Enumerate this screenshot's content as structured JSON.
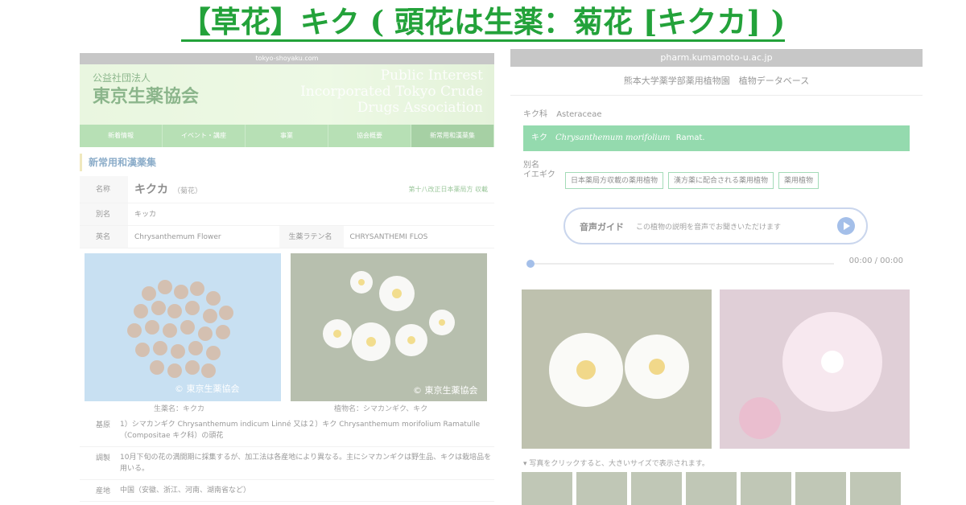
{
  "title": "【草花】キク ( 頭花は生薬：菊花 [キクカ] )",
  "left": {
    "url": "tokyo-shoyaku.com",
    "org_small": "公益社団法人",
    "org_big": "東京生薬協会",
    "org_eng": "Public Interest Incorporated Tokyo Crude Drugs Association",
    "nav": [
      "新着情報",
      "イベント・講座",
      "事業",
      "協会概要",
      "新常用和漢薬集"
    ],
    "section": "新常用和漢薬集",
    "name_label": "名称",
    "name_main": "キクカ",
    "name_sub": "（菊花）",
    "pharmacopoeia": "第十八改正日本薬局方 収載",
    "alias_label": "別名",
    "alias_value": "キッカ",
    "eng_label": "英名",
    "eng_value": "Chrysanthemum Flower",
    "latin_label": "生薬ラテン名",
    "latin_value": "CHRYSANTHEMI FLOS",
    "img_copyright_a": "© 東京生薬協会",
    "img_copyright_b": "© 東京生薬協会",
    "caption_a": "生薬名：キクカ",
    "caption_b": "植物名：シマカンギク、キク",
    "desc": [
      {
        "k": "基原",
        "v": "1）シマカンギク Chrysanthemum indicum Linné 又は２）キク Chrysanthemum morifolium Ramatulle（Compositae キク科）の頭花"
      },
      {
        "k": "調製",
        "v": "10月下旬の花の満開期に採集するが、加工法は各産地により異なる。主にシマカンギクは野生品、キクは栽培品を用いる。"
      },
      {
        "k": "産地",
        "v": "中国（安徽、浙江、河南、湖南省など）"
      }
    ]
  },
  "right": {
    "url": "pharm.kumamoto-u.ac.jp",
    "header": "熊本大学薬学部薬用植物園　植物データベース",
    "family_label": "キク科",
    "family_value": "Asteraceae",
    "species_label": "キク",
    "species_sci": "Chrysanthemum morifolium",
    "species_author": "Ramat.",
    "alias_label": "別名",
    "alias_value": "イエギク",
    "tags": [
      "日本薬局方収載の薬用植物",
      "漢方薬に配合される薬用植物",
      "薬用植物"
    ],
    "audio_title": "音声ガイド",
    "audio_desc": "この植物の説明を音声でお聞きいただけます",
    "time": "00:00 / 00:00",
    "note": "▾ 写真をクリックすると、大きいサイズで表示されます。"
  }
}
